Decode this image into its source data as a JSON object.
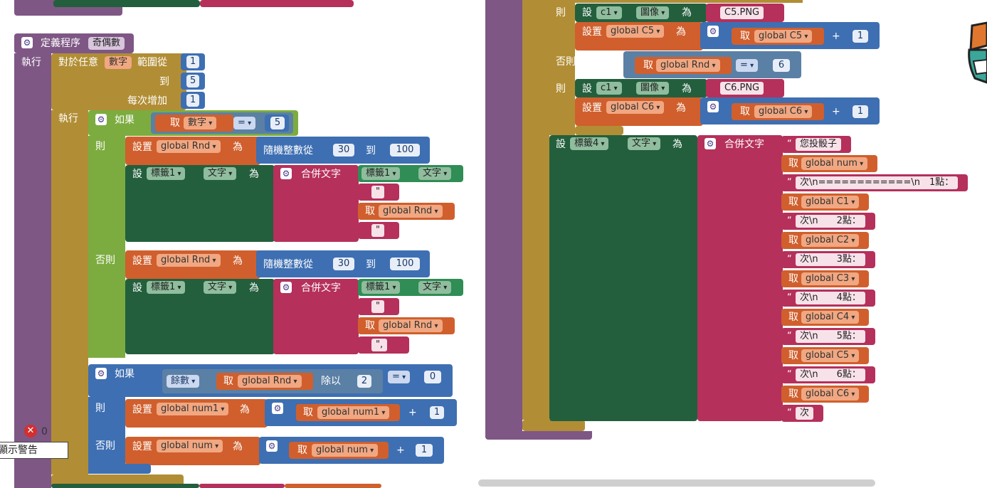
{
  "left": {
    "proc_keyword": "定義程序",
    "proc_name": "奇偶數",
    "exec": "執行",
    "for_label": "對於任意",
    "for_var": "數字",
    "range_from": "範圍從",
    "from_val": "1",
    "to_label": "到",
    "to_val": "5",
    "step_label": "每次增加",
    "step_val": "1",
    "exec2": "執行",
    "if1": {
      "if": "如果",
      "get": "取",
      "var": "數字",
      "op": "=",
      "val": "5",
      "then": "則",
      "set": "設置",
      "set_var": "global Rnd",
      "as": "為",
      "random": "隨機整數從",
      "r_from": "30",
      "r_to_label": "到",
      "r_to": "100",
      "set2": "設",
      "comp": "標籤1",
      "prop": "文字",
      "join": "合併文字",
      "j1_comp": "標籤1",
      "j1_prop": "文字",
      "j2": "\"",
      "j3_get": "取",
      "j3_var": "global Rnd",
      "j4": "\""
    },
    "else1": {
      "else": "否則",
      "set": "設置",
      "set_var": "global Rnd",
      "as": "為",
      "random": "隨機整數從",
      "r_from": "30",
      "r_to_label": "到",
      "r_to": "100",
      "set2": "設",
      "comp": "標籤1",
      "prop": "文字",
      "join": "合併文字",
      "j1_comp": "標籤1",
      "j1_prop": "文字",
      "j2": "\"",
      "j3_get": "取",
      "j3_var": "global Rnd",
      "j4": "\","
    },
    "if2": {
      "if": "如果",
      "mod": "餘數",
      "get": "取",
      "var": "global Rnd",
      "div": "除以",
      "div_val": "2",
      "op": "=",
      "val": "0",
      "then": "則",
      "set": "設置",
      "set_var": "global num1",
      "as": "為",
      "add_get": "取",
      "add_var": "global num1",
      "plus": "+",
      "add_val": "1",
      "else": "否則",
      "set_b": "設置",
      "set_var_b": "global num",
      "as_b": "為",
      "add_get_b": "取",
      "add_var_b": "global num",
      "plus_b": "+",
      "add_val_b": "1"
    },
    "warn_count": "0",
    "warn_label": "顯示警告"
  },
  "right": {
    "then": "則",
    "set": "設",
    "c1": "c1",
    "img": "圖像",
    "as": "為",
    "c5png": "C5.PNG",
    "setc5": "設置",
    "c5var": "global C5",
    "get": "取",
    "plus": "+",
    "one": "1",
    "elseif": "否則，如果",
    "rnd": "global Rnd",
    "eq": "=",
    "six": "6",
    "c6png": "C6.PNG",
    "c6var": "global C6",
    "label4": "標籤4",
    "text": "文字",
    "join": "合併文字",
    "items": [
      {
        "type": "str",
        "text": "您投骰子"
      },
      {
        "type": "get",
        "text": "global num"
      },
      {
        "type": "str",
        "text": "次\\n============\\n　1點："
      },
      {
        "type": "get",
        "text": "global C1"
      },
      {
        "type": "str",
        "text": "次\\n　　2點："
      },
      {
        "type": "get",
        "text": "global C2"
      },
      {
        "type": "str",
        "text": "次\\n　　3點："
      },
      {
        "type": "get",
        "text": "global C3"
      },
      {
        "type": "str",
        "text": "次\\n　　4點："
      },
      {
        "type": "get",
        "text": "global C4"
      },
      {
        "type": "str",
        "text": "次\\n　　5點："
      },
      {
        "type": "get",
        "text": "global C5"
      },
      {
        "type": "str",
        "text": "次\\n　　6點："
      },
      {
        "type": "get",
        "text": "global C6"
      },
      {
        "type": "str",
        "text": "次"
      }
    ]
  }
}
